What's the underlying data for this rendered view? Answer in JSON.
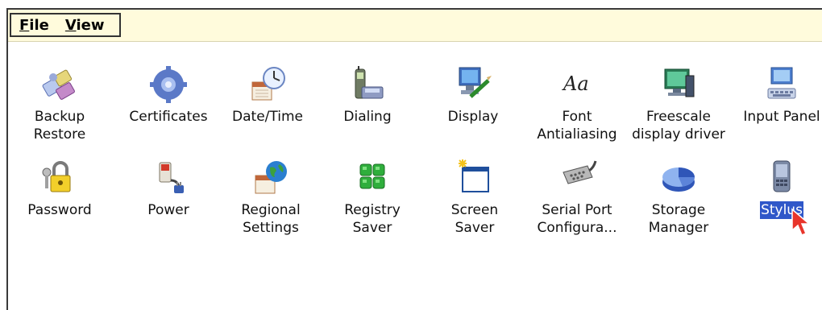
{
  "menu": {
    "file": "File",
    "file_mnemonic": "F",
    "file_rest": "ile",
    "view": "View",
    "view_mnemonic": "V",
    "view_rest": "iew"
  },
  "items": [
    {
      "label": "Backup\nRestore",
      "icon": "backup-restore-icon"
    },
    {
      "label": "Certificates",
      "icon": "certificates-icon"
    },
    {
      "label": "Date/Time",
      "icon": "date-time-icon"
    },
    {
      "label": "Dialing",
      "icon": "dialing-icon"
    },
    {
      "label": "Display",
      "icon": "display-icon"
    },
    {
      "label": "Font\nAntialiasing",
      "icon": "font-antialiasing-icon"
    },
    {
      "label": "Freescale\ndisplay driver",
      "icon": "freescale-display-driver-icon"
    },
    {
      "label": "Input Panel",
      "icon": "input-panel-icon"
    },
    {
      "label": "Password",
      "icon": "password-icon"
    },
    {
      "label": "Power",
      "icon": "power-icon"
    },
    {
      "label": "Regional\nSettings",
      "icon": "regional-settings-icon"
    },
    {
      "label": "Registry\nSaver",
      "icon": "registry-saver-icon"
    },
    {
      "label": "Screen\nSaver",
      "icon": "screen-saver-icon"
    },
    {
      "label": "Serial Port\nConfigura...",
      "icon": "serial-port-icon"
    },
    {
      "label": "Storage\nManager",
      "icon": "storage-manager-icon"
    },
    {
      "label": "Stylus",
      "icon": "stylus-icon",
      "selected": true
    }
  ],
  "colors": {
    "menubar": "#fffbdc",
    "selection": "#2f57c9"
  }
}
